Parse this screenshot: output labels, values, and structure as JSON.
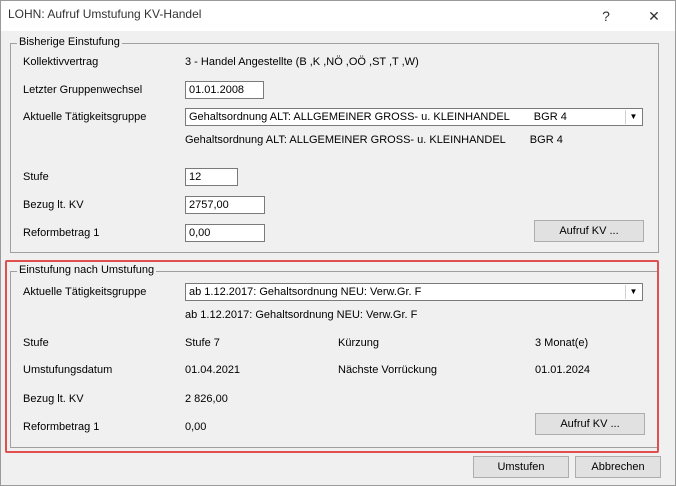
{
  "window": {
    "title": "LOHN: Aufruf Umstufung KV-Handel",
    "help_label": "?",
    "close_label": "✕"
  },
  "bisherige": {
    "legend": "Bisherige Einstufung",
    "kollektivvertrag_label": "Kollektivvertrag",
    "kollektivvertrag_value": "3 - Handel Angestellte (B ,K ,NÖ ,OÖ ,ST ,T ,W)",
    "gruppenwechsel_label": "Letzter Gruppenwechsel",
    "gruppenwechsel_value": "01.01.2008",
    "taetigkeit_label": "Aktuelle Tätigkeitsgruppe",
    "taetigkeit_combo": "Gehaltsordnung ALT: ALLGEMEINER GROSS- u. KLEINHANDEL        BGR 4",
    "taetigkeit_text": "Gehaltsordnung ALT: ALLGEMEINER GROSS- u. KLEINHANDEL        BGR 4",
    "stufe_label": "Stufe",
    "stufe_value": "12",
    "bezug_label": "Bezug lt. KV",
    "bezug_value": "2757,00",
    "reform_label": "Reformbetrag 1",
    "reform_value": "0,00",
    "aufruf_button": "Aufruf KV ..."
  },
  "nach": {
    "legend": "Einstufung nach Umstufung",
    "taetigkeit_label": "Aktuelle Tätigkeitsgruppe",
    "taetigkeit_combo": "ab 1.12.2017: Gehaltsordnung NEU: Verw.Gr. F",
    "taetigkeit_text": "ab 1.12.2017: Gehaltsordnung NEU: Verw.Gr. F",
    "stufe_label": "Stufe",
    "stufe_value": "Stufe 7",
    "kuerzung_label": "Kürzung",
    "kuerzung_value": "3 Monat(e)",
    "datum_label": "Umstufungsdatum",
    "datum_value": "01.04.2021",
    "vorrueckung_label": "Nächste Vorrückung",
    "vorrueckung_value": "01.01.2024",
    "bezug_label": "Bezug lt. KV",
    "bezug_value": "2 826,00",
    "reform_label": "Reformbetrag 1",
    "reform_value": "0,00",
    "aufruf_button": "Aufruf KV ..."
  },
  "footer": {
    "umstufen_button": "Umstufen",
    "abbrechen_button": "Abbrechen"
  },
  "colors": {
    "highlight": "#e05050",
    "window_bg": "#f0f0f0"
  }
}
